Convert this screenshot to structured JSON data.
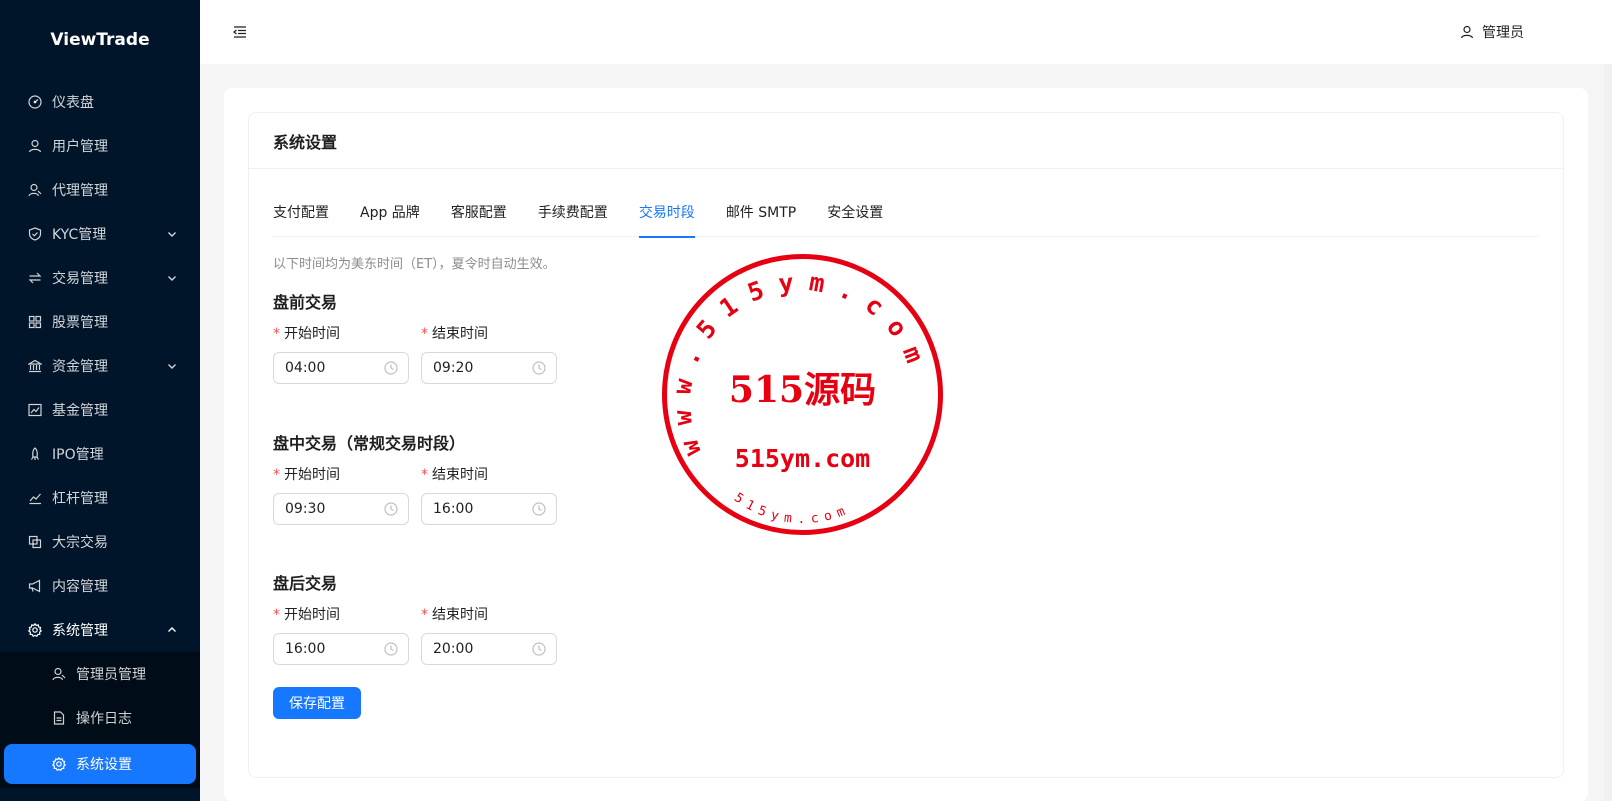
{
  "app": {
    "title": "ViewTrade"
  },
  "header": {
    "user_name": "管理员"
  },
  "sidebar": {
    "items": [
      {
        "label": "仪表盘",
        "icon": "dashboard-icon"
      },
      {
        "label": "用户管理",
        "icon": "user-icon"
      },
      {
        "label": "代理管理",
        "icon": "agents-icon"
      },
      {
        "label": "KYC管理",
        "icon": "shield-icon",
        "expandable": true
      },
      {
        "label": "交易管理",
        "icon": "swap-icon",
        "expandable": true
      },
      {
        "label": "股票管理",
        "icon": "grid-icon"
      },
      {
        "label": "资金管理",
        "icon": "bank-icon",
        "expandable": true
      },
      {
        "label": "基金管理",
        "icon": "fund-chart-icon"
      },
      {
        "label": "IPO管理",
        "icon": "rocket-icon"
      },
      {
        "label": "杠杆管理",
        "icon": "line-chart-icon"
      },
      {
        "label": "大宗交易",
        "icon": "block-icon"
      },
      {
        "label": "内容管理",
        "icon": "megaphone-icon"
      },
      {
        "label": "系统管理",
        "icon": "gear-icon",
        "expanded": true
      }
    ],
    "sub_items": [
      {
        "label": "管理员管理",
        "icon": "admin-icon"
      },
      {
        "label": "操作日志",
        "icon": "file-icon"
      },
      {
        "label": "系统设置",
        "icon": "gear-icon",
        "active": true
      }
    ]
  },
  "page": {
    "card_title": "系统设置",
    "tabs": [
      {
        "label": "支付配置"
      },
      {
        "label": "App 品牌"
      },
      {
        "label": "客服配置"
      },
      {
        "label": "手续费配置"
      },
      {
        "label": "交易时段",
        "active": true
      },
      {
        "label": "邮件 SMTP"
      },
      {
        "label": "安全设置"
      }
    ],
    "note": "以下时间均为美东时间（ET），夏令时自动生效。",
    "start_label": "开始时间",
    "end_label": "结束时间",
    "sessions": [
      {
        "title": "盘前交易",
        "start": "04:00",
        "end": "09:20"
      },
      {
        "title": "盘中交易（常规交易时段）",
        "start": "09:30",
        "end": "16:00"
      },
      {
        "title": "盘后交易",
        "start": "16:00",
        "end": "20:00"
      }
    ],
    "save_label": "保存配置"
  },
  "watermark": {
    "ring_text": "www.515ym.com",
    "center_text": "515源码",
    "domain_text": "515ym.com",
    "bottom_text": "515ym.com",
    "color": "#e60012"
  },
  "colors": {
    "primary": "#1677ff",
    "sidebar_bg": "#001529",
    "required": "#ff4d4f"
  }
}
